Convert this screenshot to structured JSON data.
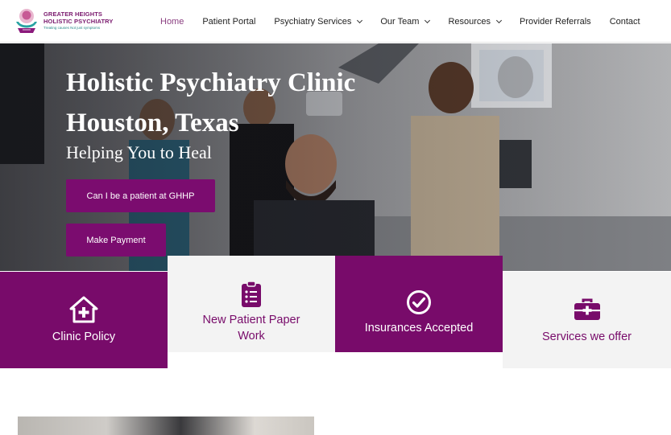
{
  "header": {
    "logo": {
      "line1": "GREATER HEIGHTS",
      "line2": "HOLISTIC PSYCHIATRY",
      "tagline": "Treating causes Not just symptoms"
    },
    "nav": [
      {
        "label": "Home",
        "active": true,
        "dropdown": false
      },
      {
        "label": "Patient Portal",
        "active": false,
        "dropdown": false
      },
      {
        "label": "Psychiatry Services",
        "active": false,
        "dropdown": true
      },
      {
        "label": "Our Team",
        "active": false,
        "dropdown": true
      },
      {
        "label": "Resources",
        "active": false,
        "dropdown": true
      },
      {
        "label": "Provider Referrals",
        "active": false,
        "dropdown": false
      },
      {
        "label": "Contact",
        "active": false,
        "dropdown": false
      }
    ]
  },
  "hero": {
    "title_line1": "Holistic Psychiatry Clinic",
    "title_line2": "Houston, Texas",
    "subtitle": "Helping You to Heal",
    "button_patient": "Can I be a patient at GHHP",
    "button_payment": "Make Payment"
  },
  "tiles": [
    {
      "label": "Clinic Policy",
      "icon": "house-medical-icon",
      "theme": "dark"
    },
    {
      "label": "New Patient Paper Work",
      "icon": "clipboard-list-icon",
      "theme": "light"
    },
    {
      "label": "Insurances Accepted",
      "icon": "check-circle-icon",
      "theme": "dark"
    },
    {
      "label": "Services we offer",
      "icon": "medical-kit-icon",
      "theme": "light"
    }
  ],
  "colors": {
    "brand": "#780b6a",
    "nav_active": "#8a3e80",
    "tile_light": "#f3f3f3"
  }
}
